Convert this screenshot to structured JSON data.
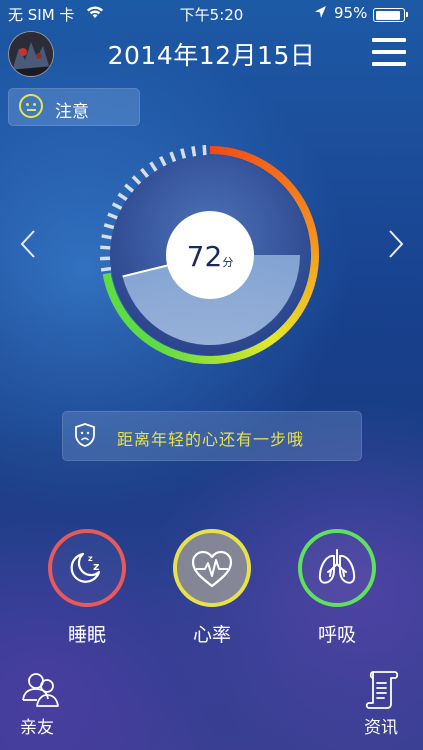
{
  "status_bar": {
    "carrier": "无 SIM 卡",
    "time": "下午5:20",
    "battery": "95%"
  },
  "header": {
    "date": "2014年12月15日"
  },
  "status_chip": {
    "label": "注意",
    "icon": "neutral-face-icon"
  },
  "score": {
    "value": "72",
    "unit": "分",
    "fraction": 0.72
  },
  "message": {
    "text": "距离年轻的心还有一步哦",
    "icon": "sad-face-shield-icon"
  },
  "metrics": [
    {
      "label": "睡眠",
      "icon": "moon-sleep-icon",
      "color": "#e8595a",
      "active": false
    },
    {
      "label": "心率",
      "icon": "heart-rate-icon",
      "color": "#e8e24a",
      "active": true
    },
    {
      "label": "呼吸",
      "icon": "lungs-icon",
      "color": "#5fe05f",
      "active": false
    }
  ],
  "bottom_nav": {
    "left": {
      "label": "亲友",
      "icon": "friends-icon"
    },
    "right": {
      "label": "资讯",
      "icon": "scroll-news-icon"
    }
  },
  "colors": {
    "accent_yellow": "#e8e24a",
    "gauge_red": "#f24a18",
    "gauge_orange": "#f7901e",
    "gauge_yellow": "#e6e62a",
    "gauge_green": "#5fdc44"
  }
}
